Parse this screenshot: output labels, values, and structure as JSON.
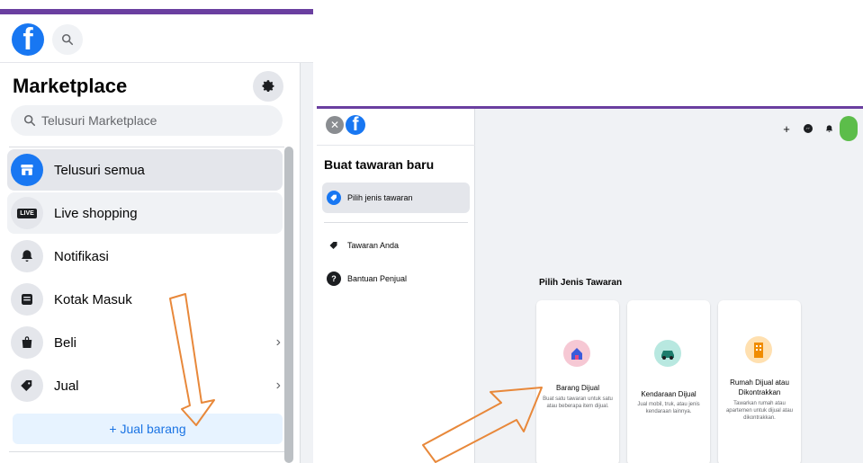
{
  "left": {
    "title": "Marketplace",
    "search_placeholder": "Telusuri Marketplace",
    "nav": [
      {
        "label": "Telusuri semua",
        "icon": "storefront-icon"
      },
      {
        "label": "Live shopping",
        "icon": "live-icon",
        "badge": "LIVE"
      },
      {
        "label": "Notifikasi",
        "icon": "bell-icon"
      },
      {
        "label": "Kotak Masuk",
        "icon": "inbox-icon"
      },
      {
        "label": "Beli",
        "icon": "bag-icon"
      },
      {
        "label": "Jual",
        "icon": "tag-icon"
      }
    ],
    "sell_button": "+ Jual barang"
  },
  "right": {
    "title": "Buat tawaran baru",
    "nav": [
      {
        "label": "Pilih jenis tawaran",
        "icon": "tag-icon"
      },
      {
        "label": "Tawaran Anda",
        "icon": "tag-icon"
      },
      {
        "label": "Bantuan Penjual",
        "icon": "help-icon"
      }
    ],
    "section_title": "Pilih Jenis Tawaran",
    "cards": [
      {
        "title": "Barang Dijual",
        "desc": "Buat satu tawaran untuk satu atau beberapa item dijual."
      },
      {
        "title": "Kendaraan Dijual",
        "desc": "Jual mobil, truk, atau jenis kendaraan lainnya."
      },
      {
        "title": "Rumah Dijual atau Dikontrakkan",
        "desc": "Tawarkan rumah atau apartemen untuk dijual atau dikontrakkan."
      }
    ]
  },
  "colors": {
    "brand": "#1877f2",
    "accent_bar": "#6a3fa0",
    "annotation_arrow": "#e8883a"
  }
}
